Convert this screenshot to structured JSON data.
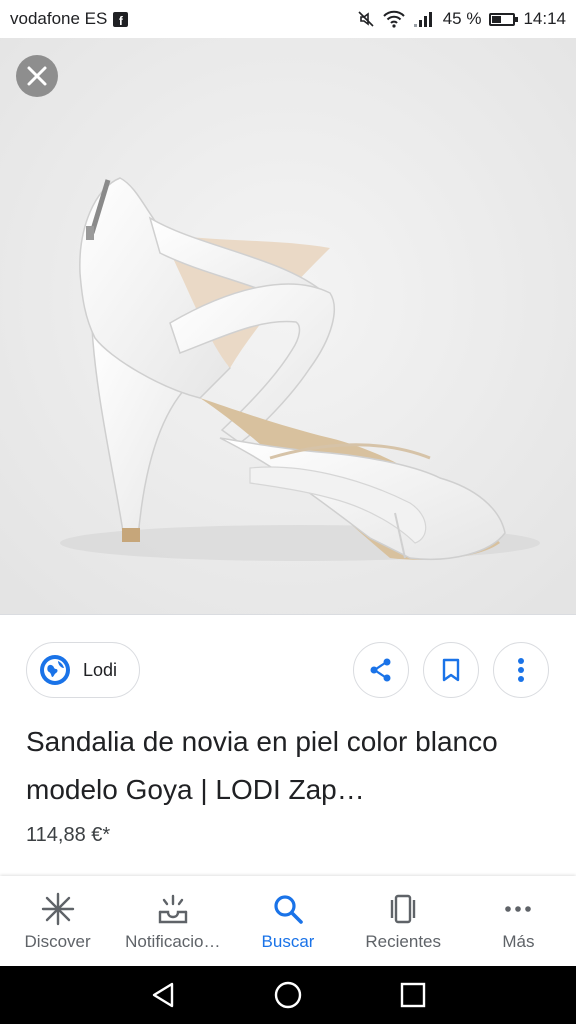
{
  "status_bar": {
    "carrier": "vodafone ES",
    "carrier_app_icon": "facebook-icon",
    "battery_percent_label": "45 %",
    "battery_level": 0.45,
    "time": "14:14"
  },
  "viewer": {
    "close_icon": "close-icon",
    "image_subject": "white bridal high-heel sandal"
  },
  "source": {
    "name": "Lodi",
    "icon": "globe-icon"
  },
  "actions": {
    "share_icon": "share-icon",
    "save_icon": "bookmark-icon",
    "more_icon": "more-vert-icon"
  },
  "result": {
    "title": "Sandalia de novia en piel color blanco modelo Goya | LODI Zap…",
    "price": "114,88 €*"
  },
  "bottom_nav": {
    "items": [
      {
        "label": "Discover",
        "icon": "asterisk-icon"
      },
      {
        "label": "Notificacio…",
        "icon": "notifications-tray-icon"
      },
      {
        "label": "Buscar",
        "icon": "search-icon",
        "active": true
      },
      {
        "label": "Recientes",
        "icon": "recent-cards-icon"
      },
      {
        "label": "Más",
        "icon": "more-horiz-icon"
      }
    ]
  },
  "system_nav": {
    "back_icon": "back-triangle-icon",
    "home_icon": "home-circle-icon",
    "recents_icon": "recents-square-icon"
  },
  "colors": {
    "accent": "#1a73e8",
    "text": "#202124",
    "secondary_text": "#5f6368"
  }
}
